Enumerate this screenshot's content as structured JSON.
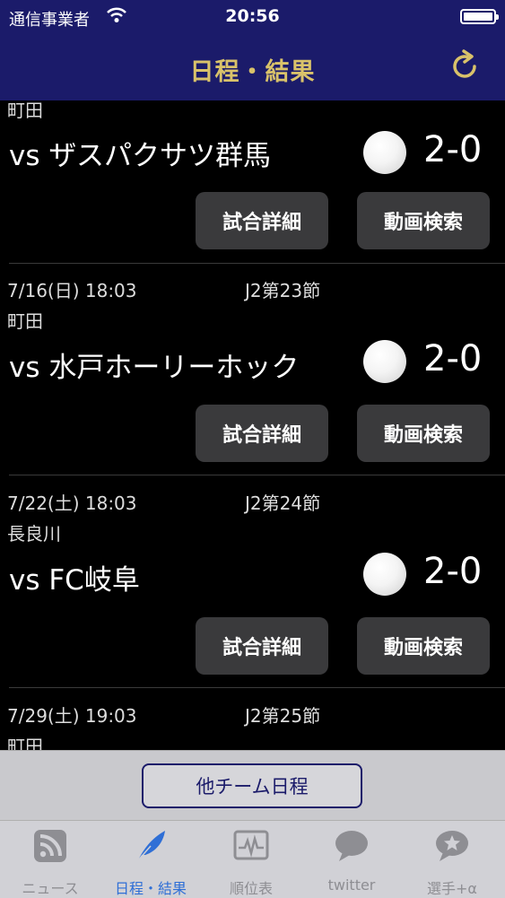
{
  "status_bar": {
    "carrier": "通信事業者",
    "time": "20:56"
  },
  "nav": {
    "title": "日程・結果"
  },
  "matches": [
    {
      "venue": "町田",
      "opponent": "vs ザスパクサツ群馬",
      "score": "2-0",
      "detail_label": "試合詳細",
      "video_label": "動画検索"
    },
    {
      "date": "7/16(日) 18:03",
      "section": "J2第23節",
      "venue": "町田",
      "opponent": "vs 水戸ホーリーホック",
      "score": "2-0",
      "detail_label": "試合詳細",
      "video_label": "動画検索"
    },
    {
      "date": "7/22(土) 18:03",
      "section": "J2第24節",
      "venue": "長良川",
      "opponent": "vs FC岐阜",
      "score": "2-0",
      "detail_label": "試合詳細",
      "video_label": "動画検索"
    },
    {
      "date": "7/29(土) 19:03",
      "section": "J2第25節",
      "venue": "町田"
    }
  ],
  "other_schedule_button": "他チーム日程",
  "tabs": [
    {
      "label": "ニュース",
      "icon": "rss-icon"
    },
    {
      "label": "日程・結果",
      "icon": "feather-icon"
    },
    {
      "label": "順位表",
      "icon": "chart-icon"
    },
    {
      "label": "twitter",
      "icon": "speech-bubble-icon"
    },
    {
      "label": "選手+α",
      "icon": "star-bubble-icon"
    }
  ],
  "colors": {
    "nav_bg": "#1b1b6a",
    "title": "#d9c26a",
    "active_tab": "#2f6fd6",
    "inactive_tab": "#8e8e93"
  }
}
